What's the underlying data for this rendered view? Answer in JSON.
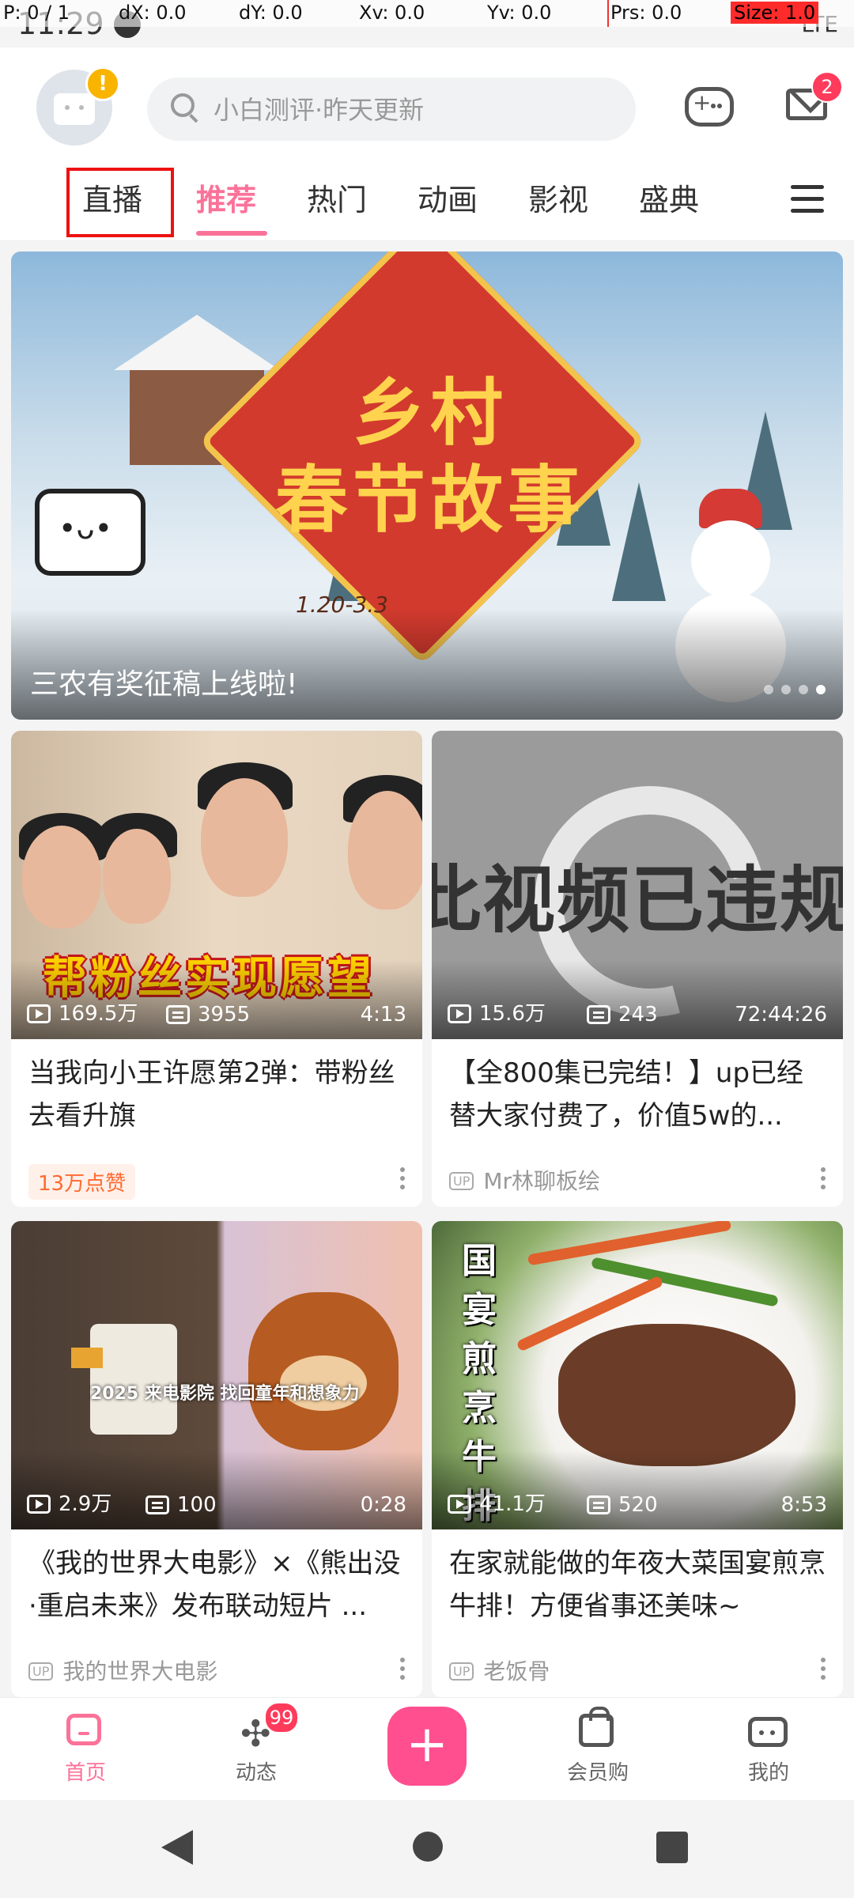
{
  "debug": {
    "pointer": "P: 0 / 1",
    "dx": "dX: 0.0",
    "dy": "dY: 0.0",
    "xv": "Xv: 0.0",
    "yv": "Yv: 0.0",
    "prs": "Prs: 0.0",
    "size": "Size: 1.0"
  },
  "status_bar": {
    "time": "11:29",
    "signal": "LTE"
  },
  "header": {
    "avatar_badge": "!",
    "search_placeholder": "小白测评·昨天更新",
    "mail_badge": "2"
  },
  "tabs": {
    "items": [
      "直播",
      "推荐",
      "热门",
      "动画",
      "影视",
      "盛典"
    ],
    "active": "推荐",
    "highlighted": "直播"
  },
  "banner": {
    "title_line1": "乡村",
    "title_line2": "春节故事",
    "date": "1.20-3.3",
    "caption": "三农有奖征稿上线啦!",
    "page_count": 4,
    "current_page": 4
  },
  "cards": [
    {
      "thumb_text": "帮粉丝实现愿望",
      "views": "169.5万",
      "danmaku": "3955",
      "duration": "4:13",
      "title": "当我向小王许愿第2弹：带粉丝去看升旗",
      "tag": "13万点赞"
    },
    {
      "thumb_text": "此视频已违规",
      "views": "15.6万",
      "danmaku": "243",
      "duration": "72:44:26",
      "title": "【全800集已完结！】up已经替大家付费了，价值5w的...",
      "uploader": "Mr林聊板绘"
    },
    {
      "thumb_text": "2025 来电影院 找回童年和想象力",
      "views": "2.9万",
      "danmaku": "100",
      "duration": "0:28",
      "title": "《我的世界大电影》×《熊出没·重启未来》发布联动短片 ...",
      "uploader": "我的世界大电影"
    },
    {
      "thumb_text": "国宴煎烹牛排",
      "views": "41.1万",
      "danmaku": "520",
      "duration": "8:53",
      "title": "在家就能做的年夜大菜国宴煎烹牛排！方便省事还美味~",
      "uploader": "老饭骨"
    }
  ],
  "up_label": "UP",
  "bottom_nav": {
    "items": [
      "首页",
      "动态",
      "",
      "会员购",
      "我的"
    ],
    "active": "首页",
    "dynamic_badge": "99",
    "center_button": "+"
  }
}
